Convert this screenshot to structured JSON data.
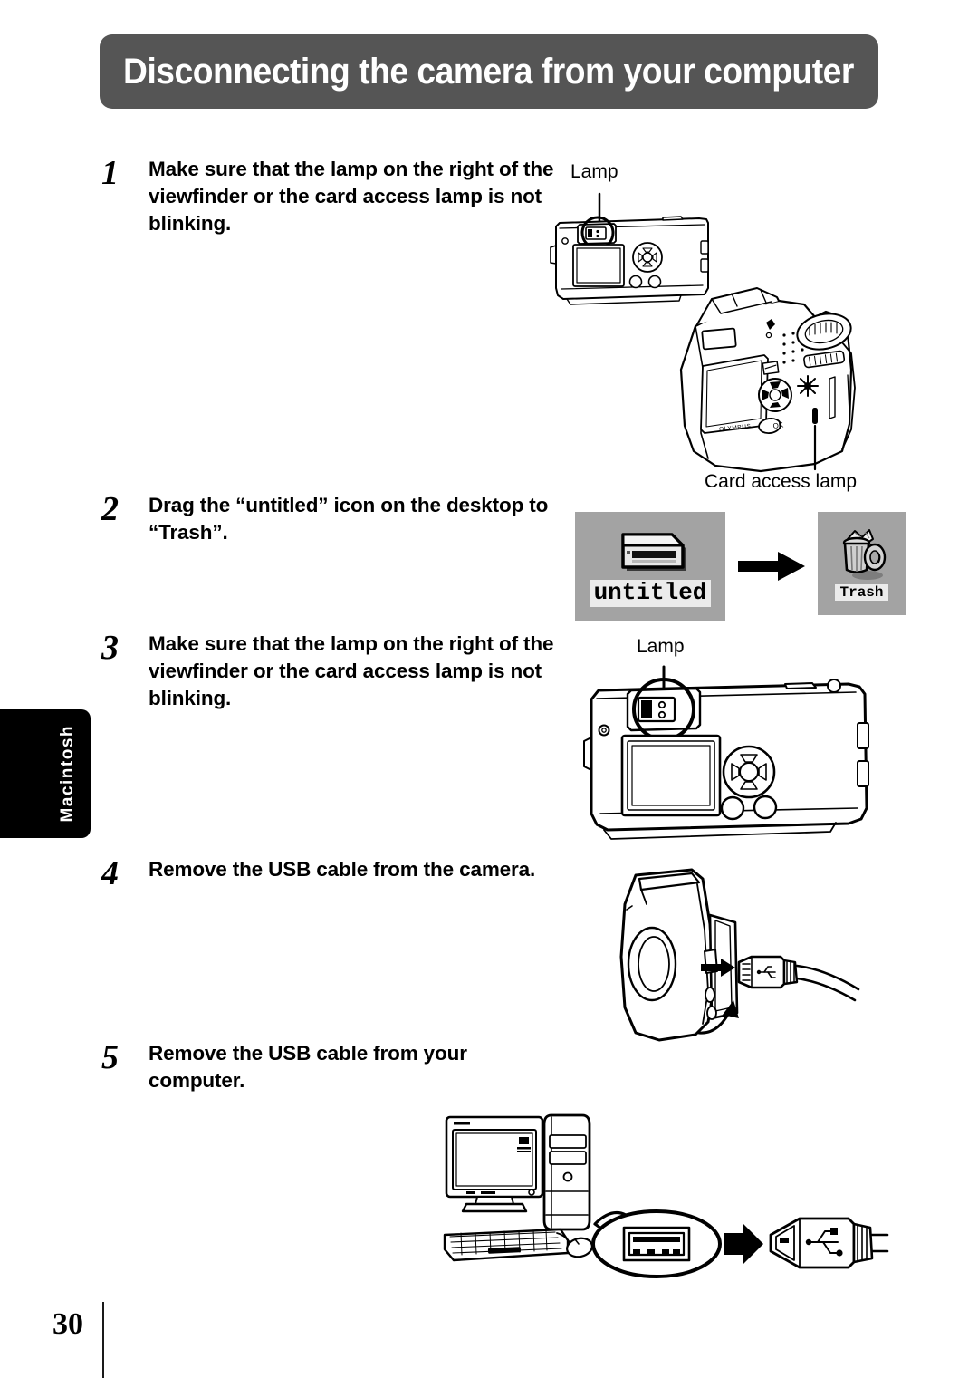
{
  "header": {
    "title": "Disconnecting the camera from your computer"
  },
  "side_tab": {
    "label": "Macintosh"
  },
  "steps": [
    {
      "number": "1",
      "text": "Make sure that the lamp on the right of the viewfinder or the card access lamp is not blinking."
    },
    {
      "number": "2",
      "text": "Drag the “untitled” icon on the desktop to “Trash”."
    },
    {
      "number": "3",
      "text": "Make sure that the lamp on the right of the viewfinder or the card access lamp is not blinking."
    },
    {
      "number": "4",
      "text": "Remove the USB cable from the camera."
    },
    {
      "number": "5",
      "text": "Remove the USB cable from your computer."
    }
  ],
  "figures": {
    "fig1": {
      "lamp_label": "Lamp",
      "card_access_label": "Card access lamp",
      "camera_brand": "OLYMPUS"
    },
    "fig2": {
      "untitled_label": "untitled",
      "trash_label": "Trash"
    },
    "fig3": {
      "lamp_label": "Lamp"
    }
  },
  "footer": {
    "page_number": "30"
  },
  "colors": {
    "header_background": "#555555",
    "header_text": "#ffffff",
    "side_tab_background": "#000000",
    "side_tab_text": "#ffffff",
    "icon_box_background": "#a3a3a3",
    "icon_caption_background": "#ebebeb",
    "body_text": "#000000",
    "page_background": "#ffffff"
  }
}
